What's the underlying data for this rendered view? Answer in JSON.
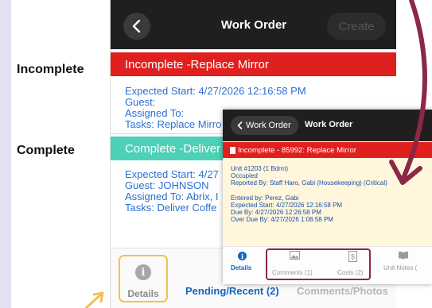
{
  "labels": {
    "incomplete": "Incomplete",
    "complete": "Complete"
  },
  "phone": {
    "title": "Work Order",
    "create_label": "Create",
    "back_icon": "chevron-left-icon",
    "incomplete": {
      "bar": "Incomplete -Replace Mirror",
      "color": "#e0201f",
      "lines": [
        "Expected Start: 4/27/2026 12:16:58 PM",
        "Guest:",
        "Assigned To:",
        "Tasks: Replace Mirro"
      ]
    },
    "complete": {
      "bar": "Complete -Deliver",
      "color": "#4dd0b6",
      "lines": [
        "Expected Start: 4/27",
        "Guest: JOHNSON",
        "Assigned To: Abrix, I",
        "Tasks: Deliver Coffe"
      ]
    },
    "tabs": {
      "details": "Details",
      "pending": "Pending/Recent (2)",
      "comments_photos": "Comments/Photos"
    }
  },
  "inset": {
    "back_label": "Work Order",
    "title": "Work Order",
    "bar": "Incomplete - 85992: Replace Mirror",
    "unit": "Unit #1203 (1 Bdrm)",
    "status": "Occupied",
    "reported_by": "Reported By: Staff Haro, Gabi (Housekeeping) (Critical)",
    "entered_by": "Entered by: Perez, Gabi",
    "expected_start": "Expected Start: 4/27/2026 12:16:58 PM",
    "due_by": "Due By: 4/27/2026 12:26:58 PM",
    "over_due_by": "Over Due By: 4/27/2026 1:06:58 PM",
    "tabs": {
      "details": "Details",
      "comments": "Comments (1)",
      "costs": "Costs (2)",
      "unit_notes": "Unit Notes ("
    }
  },
  "colors": {
    "highlight_yellow": "#f2c14e",
    "highlight_maroon": "#8a2846",
    "link_blue": "#2a6fd6",
    "pending_blue": "#1565c0"
  }
}
